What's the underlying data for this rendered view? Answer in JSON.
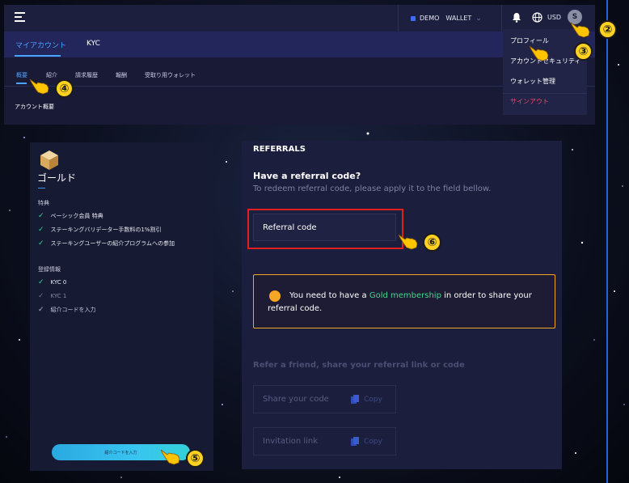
{
  "header": {
    "demo_label": "DEMO",
    "wallet_label": "WALLET",
    "currency": "USD",
    "avatar_initial": "S"
  },
  "main_tabs": [
    "マイアカウント",
    "KYC"
  ],
  "sub_tabs": [
    "概要",
    "紹介",
    "請求履歴",
    "報酬",
    "受取り用ウォレット"
  ],
  "overview_title": "アカウント概要",
  "profile_menu": {
    "items": [
      "プロフィール",
      "アカウントセキュリティ",
      "ウォレット管理"
    ],
    "signout": "サインアウト"
  },
  "membership": {
    "title": "ゴールド",
    "benefits_label": "特典",
    "benefits": [
      "ベーシック会員 特典",
      "ステーキングバリデーター手数料の1%割引",
      "ステーキングユーザーの紹介プログラムへの参加"
    ],
    "registration_label": "登録情報",
    "registration_items": [
      "KYC 0",
      "KYC 1",
      "紹介コードを入力"
    ],
    "button_label": "紹介コードを入力"
  },
  "referrals": {
    "heading": "REFERRALS",
    "question": "Have a referral code?",
    "subtitle": "To redeem referral code, please apply it to the field bellow.",
    "input_placeholder": "Referral code",
    "notice_before": "You need to have a ",
    "notice_link": "Gold membership",
    "notice_after": " in order to share your referral code.",
    "share_title": "Refer a friend, share your referral link or code",
    "share_code_label": "Share your code",
    "invitation_label": "Invitation link",
    "copy_label": "Copy"
  },
  "annotations": [
    "②",
    "③",
    "④",
    "⑤",
    "⑥"
  ],
  "colors": {
    "accent": "#4aa3ff",
    "success": "#2ed3a0",
    "warning": "#f5a623",
    "danger": "#e84a6b",
    "highlight": "#e0201c",
    "marker": "#ffd21f"
  }
}
